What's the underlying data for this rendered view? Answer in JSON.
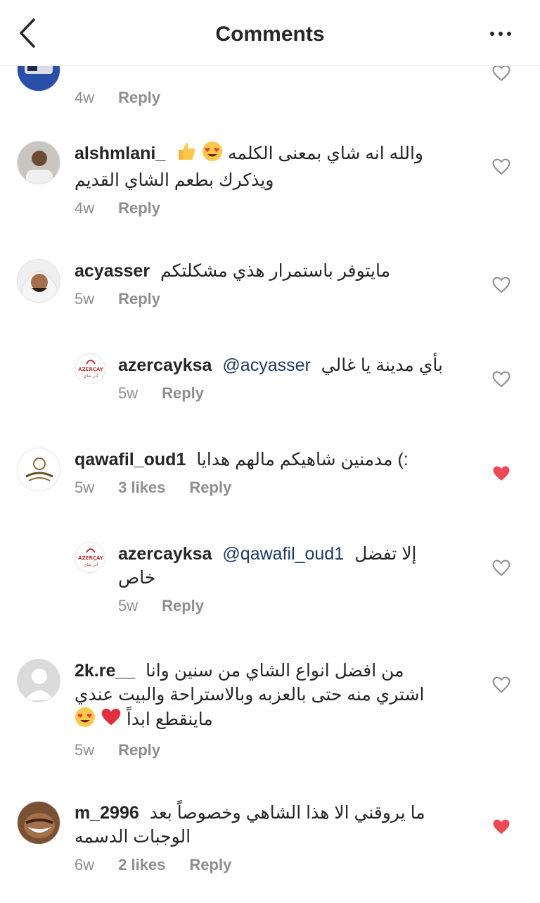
{
  "header": {
    "title": "Comments"
  },
  "comments": [
    {
      "user": "",
      "text": "",
      "time": "4w",
      "likes": "",
      "reply": "Reply",
      "liked": false
    },
    {
      "user": "alshmlani_",
      "text": "والله انه شاي بمعنى الكلمه",
      "text2": "ويذكرك بطعم الشاي القديم",
      "time": "4w",
      "likes": "",
      "reply": "Reply",
      "liked": false
    },
    {
      "user": "acyasser",
      "text": "مايتوفر باستمرار هذي مشكلتكم",
      "time": "5w",
      "likes": "",
      "reply": "Reply",
      "liked": false
    },
    {
      "user": "azercayksa",
      "mention": "@acyasser",
      "text": "بأي مدينة يا غالي",
      "time": "5w",
      "likes": "",
      "reply": "Reply",
      "liked": false,
      "avatar_text": "AZERÇAY",
      "avatar_sub": "آذر شاي"
    },
    {
      "user": "qawafil_oud1",
      "text": "مدمنين شاهيكم مالهم هدايا",
      "text_suffix": "(:",
      "time": "5w",
      "likes": "3 likes",
      "reply": "Reply",
      "liked": true
    },
    {
      "user": "azercayksa",
      "mention": "@qawafil_oud1",
      "text": "إلا تفضل",
      "text2": "خاص",
      "time": "5w",
      "likes": "",
      "reply": "Reply",
      "liked": false,
      "avatar_text": "AZERÇAY",
      "avatar_sub": "آذر شاي"
    },
    {
      "user": "2k.re__",
      "text": "من افضل انواع الشاي من سنين وانا",
      "text2": "اشتري منه حتى بالعزبه وبالاستراحة والبيت عندي",
      "text3": "ماينقطع ابداً",
      "time": "5w",
      "likes": "",
      "reply": "Reply",
      "liked": false
    },
    {
      "user": "m_2996",
      "text": "ما يروقني الا هذا الشاهي وخصوصاً بعد",
      "text2": "الوجبات الدسمه",
      "time": "6w",
      "likes": "2 likes",
      "reply": "Reply",
      "liked": true
    }
  ],
  "colors": {
    "liked_heart": "#ed4956",
    "meta": "#8e8e8e",
    "mention": "#1e3a64"
  },
  "icons": {
    "back": "chevron-left-icon",
    "more": "more-horizontal-icon",
    "heart": "heart-icon"
  }
}
